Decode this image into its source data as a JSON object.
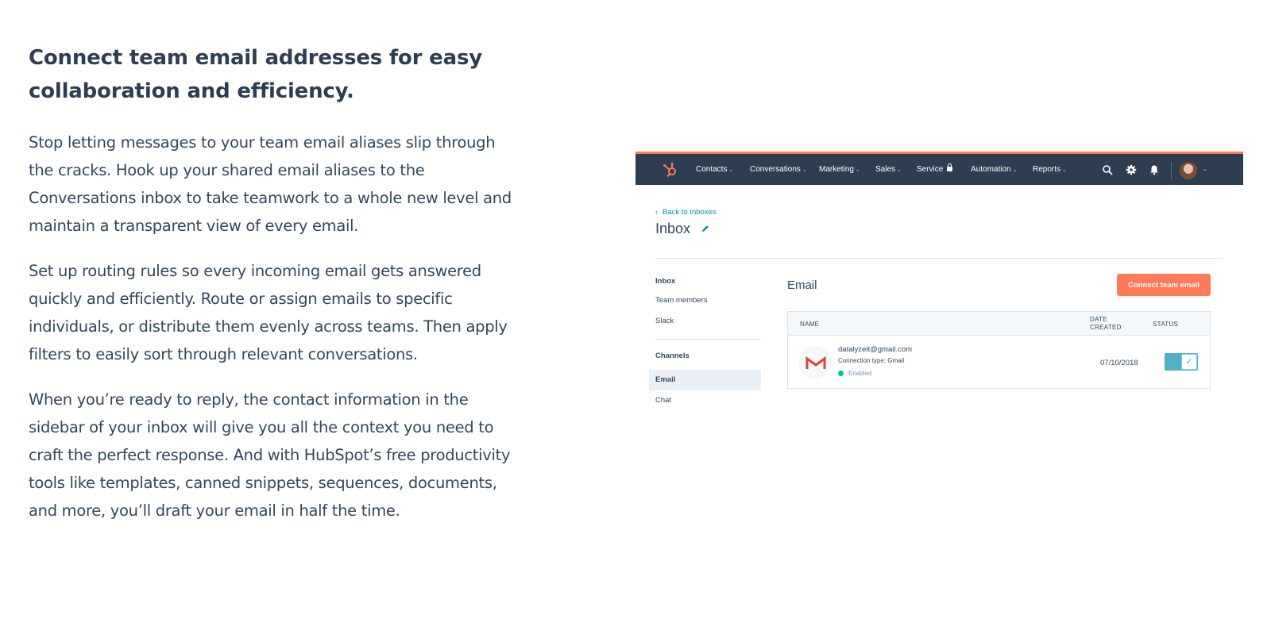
{
  "article": {
    "heading": "Connect team email addresses for easy collaboration and efficiency.",
    "paragraphs": [
      "Stop letting messages to your team email aliases slip through the cracks. Hook up your shared email aliases to the Conversations inbox to take teamwork to a whole new level and maintain a transparent view of every email.",
      "Set up routing rules so every incoming email gets answered quickly and efficiently. Route or assign emails to specific individuals, or distribute them evenly across teams. Then apply filters to easily sort through relevant conversations.",
      "When you’re ready to reply, the contact information in the sidebar of your inbox will give you all the context you need to craft the perfect response. And with HubSpot’s free productivity tools like templates, canned snippets, sequences, documents, and more, you’ll draft your email in half the time."
    ]
  },
  "app": {
    "colors": {
      "nav_bg": "#2d3e50",
      "accent": "#ff7a59",
      "link": "#0091ae",
      "toggle": "#4fb0c6",
      "status_dot": "#00bda5"
    },
    "nav": {
      "items": [
        "Contacts",
        "Conversations",
        "Marketing",
        "Sales",
        "Service",
        "Automation",
        "Reports"
      ],
      "caret": "⌄",
      "icons": [
        "search-icon",
        "gear-icon",
        "bell-icon"
      ]
    },
    "back_link": "Back to Inboxes",
    "page_title": "Inbox",
    "sidebar": {
      "group1": "Inbox",
      "items1": [
        "Team members",
        "Slack"
      ],
      "group2": "Channels",
      "items2": [
        "Email",
        "Chat"
      ],
      "active": "Email"
    },
    "section_title": "Email",
    "connect_button": "Connect team email",
    "table": {
      "headers": {
        "name": "NAME",
        "date_line1": "DATE",
        "date_line2": "CREATED",
        "status": "STATUS"
      },
      "row": {
        "address": "datalyzeit@gmail.com",
        "connection": "Connection type: Gmail",
        "state": "Enabled",
        "date": "07/10/2018",
        "toggle_on": true
      }
    }
  }
}
